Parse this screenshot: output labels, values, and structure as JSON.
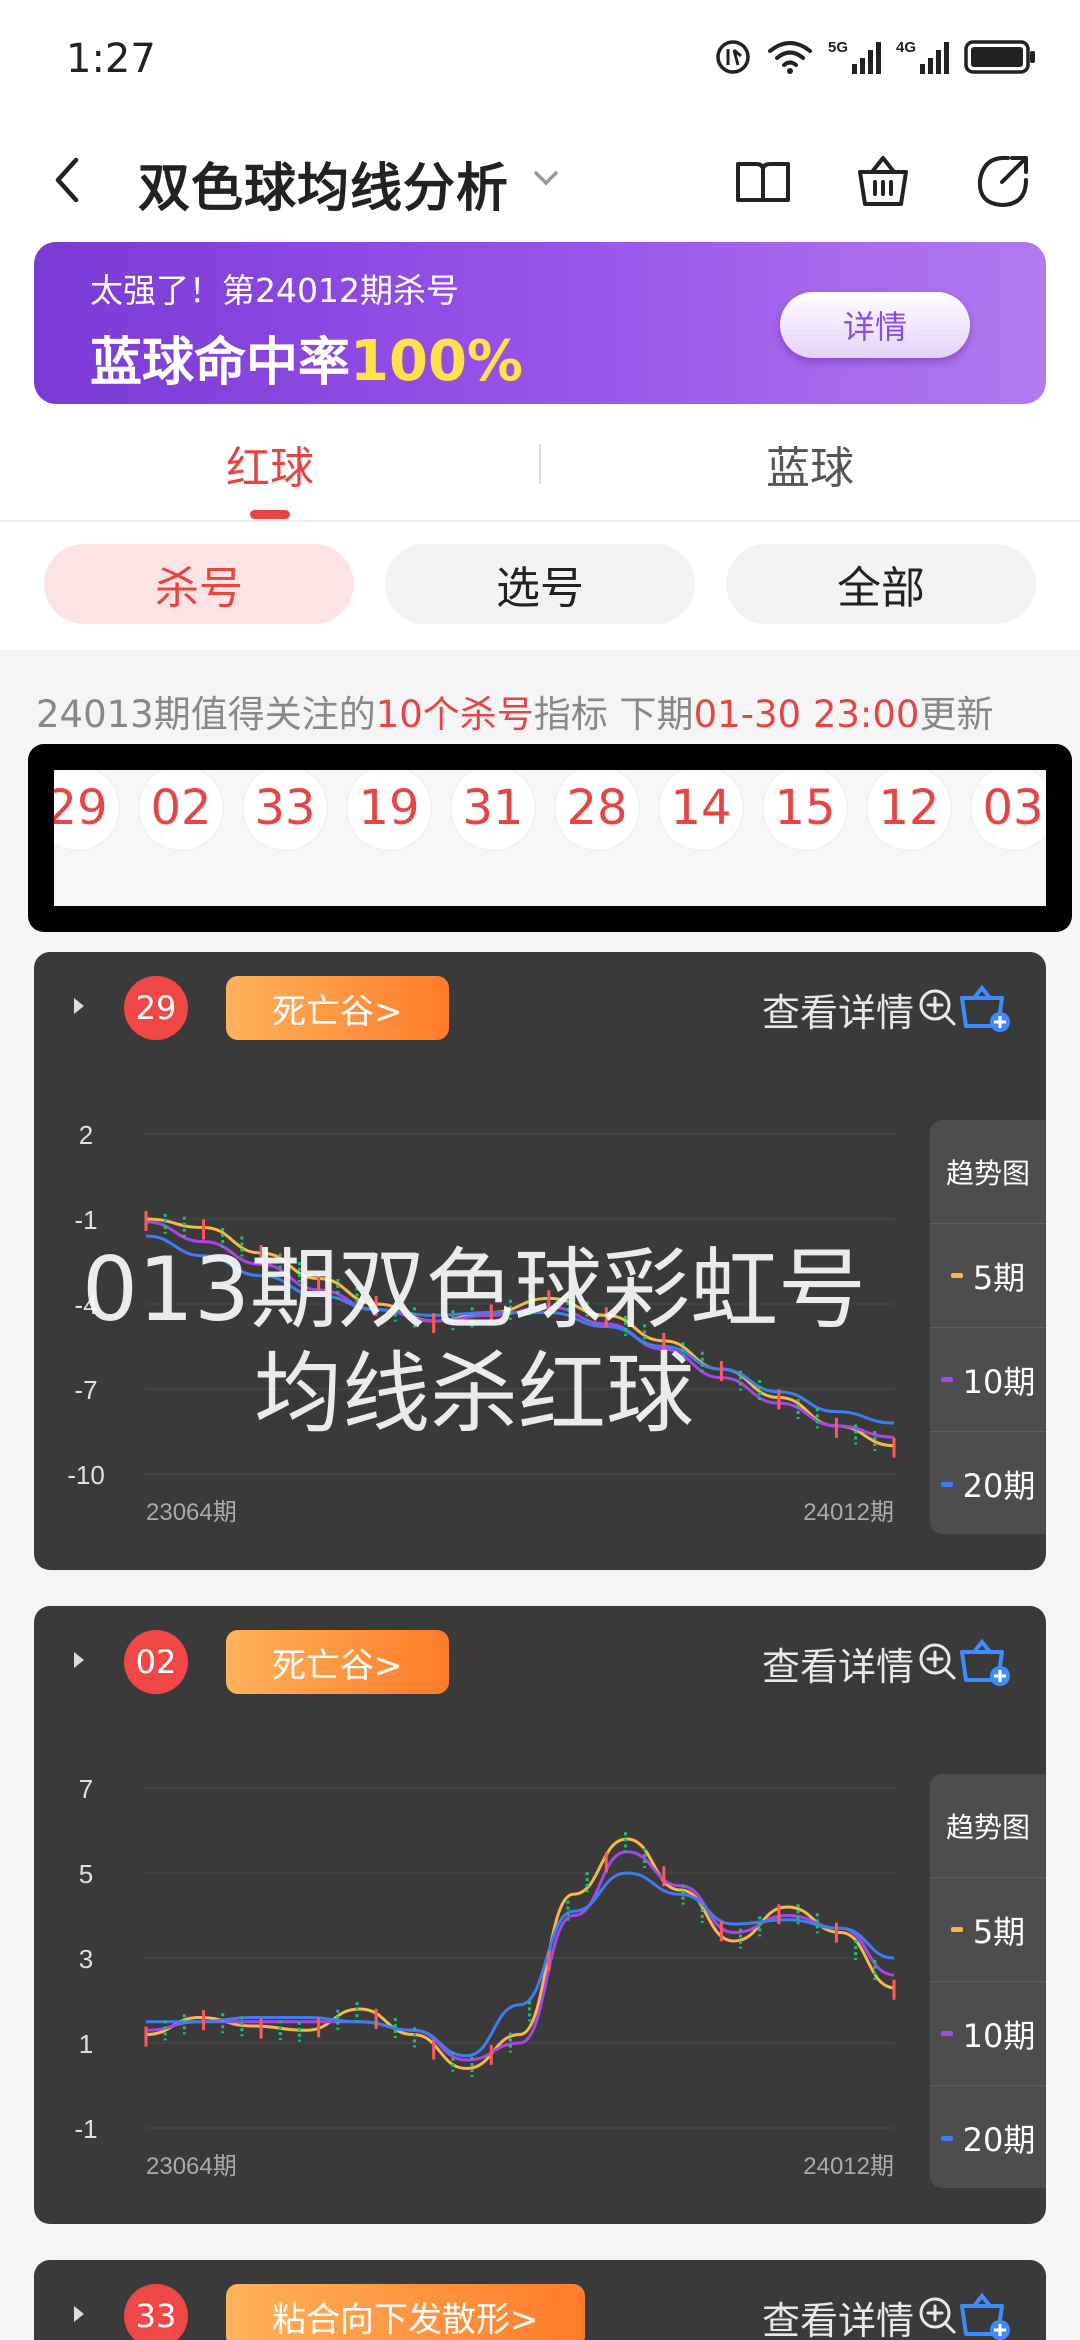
{
  "status_bar": {
    "time": "1:27",
    "signal_5g": "5G",
    "signal_4g": "4G"
  },
  "header": {
    "title": "双色球均线分析"
  },
  "banner": {
    "subtitle": "太强了！第24012期杀号",
    "main_text": "蓝球命中率",
    "highlight": "100%",
    "button": "详情",
    "colors": {
      "highlight": "#ffe14a",
      "background_start": "#7b3ad6",
      "background_end": "#b27af0"
    }
  },
  "tabs": [
    {
      "label": "红球",
      "active": true
    },
    {
      "label": "蓝球",
      "active": false
    }
  ],
  "filters": [
    {
      "label": "杀号",
      "active": true
    },
    {
      "label": "选号",
      "active": false
    },
    {
      "label": "全部",
      "active": false
    }
  ],
  "notice": {
    "part1": "24013期值得关注的",
    "highlight1": "10个杀号",
    "part2": "指标 下期",
    "highlight2": "01-30 23:00",
    "part3": "更新"
  },
  "kill_numbers": [
    "29",
    "02",
    "33",
    "19",
    "31",
    "28",
    "14",
    "15",
    "12",
    "03"
  ],
  "watermark": "013期双色球彩虹号\n均线杀红球",
  "accent_color": "#e64545",
  "cards": [
    {
      "ball": "29",
      "tag": "死亡谷>",
      "detail_label": "查看详情",
      "x_start": "23064期",
      "x_end": "24012期",
      "legend_title": "趋势图",
      "legend": [
        {
          "label": "5期",
          "color": "#f7b84a"
        },
        {
          "label": "10期",
          "color": "#a646e8"
        },
        {
          "label": "20期",
          "color": "#3f7cf0"
        }
      ]
    },
    {
      "ball": "02",
      "tag": "死亡谷>",
      "detail_label": "查看详情",
      "x_start": "23064期",
      "x_end": "24012期",
      "legend_title": "趋势图",
      "legend": [
        {
          "label": "5期",
          "color": "#f7b84a"
        },
        {
          "label": "10期",
          "color": "#a646e8"
        },
        {
          "label": "20期",
          "color": "#3f7cf0"
        }
      ]
    },
    {
      "ball": "33",
      "tag": "粘合向下发散形>",
      "detail_label": "查看详情"
    }
  ],
  "chart_data": [
    {
      "type": "line",
      "title": "",
      "y_ticks": [
        2,
        -1,
        -4,
        -7,
        -10
      ],
      "ylim": [
        -10,
        2
      ],
      "x_labels": [
        "23064期",
        "24012期"
      ],
      "series": [
        {
          "name": "5期",
          "color": "#f7b84a",
          "values": [
            -1.0,
            -1.3,
            -2.2,
            -3.1,
            -4.0,
            -4.6,
            -4.3,
            -3.8,
            -4.4,
            -5.3,
            -6.3,
            -7.3,
            -8.3,
            -9.0
          ]
        },
        {
          "name": "10期",
          "color": "#a646e8",
          "values": [
            -1.1,
            -1.8,
            -2.6,
            -3.5,
            -4.2,
            -4.6,
            -4.4,
            -4.1,
            -4.7,
            -5.6,
            -6.6,
            -7.5,
            -8.3,
            -8.7
          ]
        },
        {
          "name": "20期",
          "color": "#3f7cf0",
          "values": [
            -1.6,
            -2.3,
            -3.0,
            -3.7,
            -4.2,
            -4.4,
            -4.3,
            -4.3,
            -4.8,
            -5.5,
            -6.3,
            -7.1,
            -7.8,
            -8.2
          ]
        }
      ]
    },
    {
      "type": "line",
      "title": "",
      "y_ticks": [
        7,
        5,
        3,
        1,
        -1
      ],
      "ylim": [
        -1,
        7
      ],
      "x_labels": [
        "23064期",
        "24012期"
      ],
      "series": [
        {
          "name": "5期",
          "color": "#f7b84a",
          "values": [
            1.2,
            1.6,
            1.4,
            1.3,
            1.8,
            1.2,
            0.4,
            1.2,
            4.5,
            5.8,
            4.6,
            3.4,
            4.2,
            3.6,
            2.3
          ]
        },
        {
          "name": "10期",
          "color": "#a646e8",
          "values": [
            1.3,
            1.5,
            1.5,
            1.5,
            1.5,
            1.3,
            0.6,
            1.0,
            4.0,
            5.5,
            4.7,
            3.6,
            4.0,
            3.7,
            2.6
          ]
        },
        {
          "name": "20期",
          "color": "#3f7cf0",
          "values": [
            1.5,
            1.5,
            1.6,
            1.6,
            1.5,
            1.3,
            0.7,
            1.9,
            4.1,
            5.0,
            4.5,
            3.8,
            3.9,
            3.7,
            3.0
          ]
        }
      ]
    }
  ]
}
